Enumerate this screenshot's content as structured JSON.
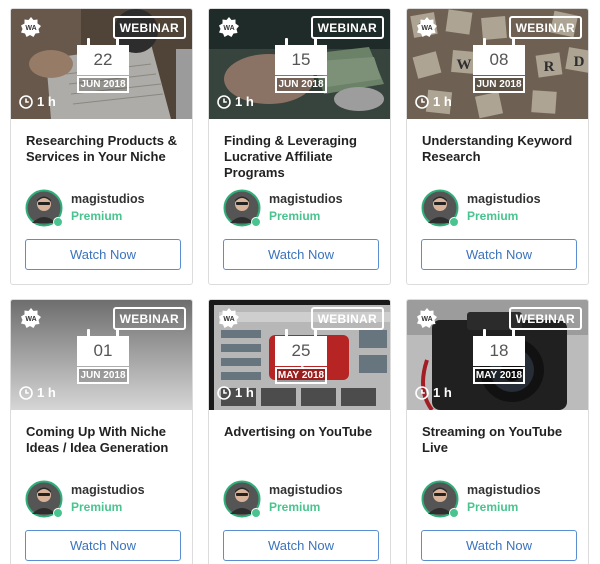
{
  "badge_label": "WEBINAR",
  "watch_label": "Watch Now",
  "colors": {
    "accent": "#3b73bd",
    "premium": "#4ac48f"
  },
  "cards": [
    {
      "day": "22",
      "month": "JUN 2018",
      "duration": "1 h",
      "title": "Researching Products & Services in Your Niche",
      "author": "magistudios",
      "tier": "Premium"
    },
    {
      "day": "15",
      "month": "JUN 2018",
      "duration": "1 h",
      "title": "Finding & Leveraging Lucrative Affiliate Programs",
      "author": "magistudios",
      "tier": "Premium"
    },
    {
      "day": "08",
      "month": "JUN 2018",
      "duration": "1 h",
      "title": "Understanding Keyword Research",
      "author": "magistudios",
      "tier": "Premium"
    },
    {
      "day": "01",
      "month": "JUN 2018",
      "duration": "1 h",
      "title": "Coming Up With Niche Ideas / Idea Generation",
      "author": "magistudios",
      "tier": "Premium"
    },
    {
      "day": "25",
      "month": "MAY 2018",
      "duration": "1 h",
      "title": "Advertising on YouTube",
      "author": "magistudios",
      "tier": "Premium"
    },
    {
      "day": "18",
      "month": "MAY 2018",
      "duration": "1 h",
      "title": "Streaming on YouTube Live",
      "author": "magistudios",
      "tier": "Premium"
    }
  ]
}
